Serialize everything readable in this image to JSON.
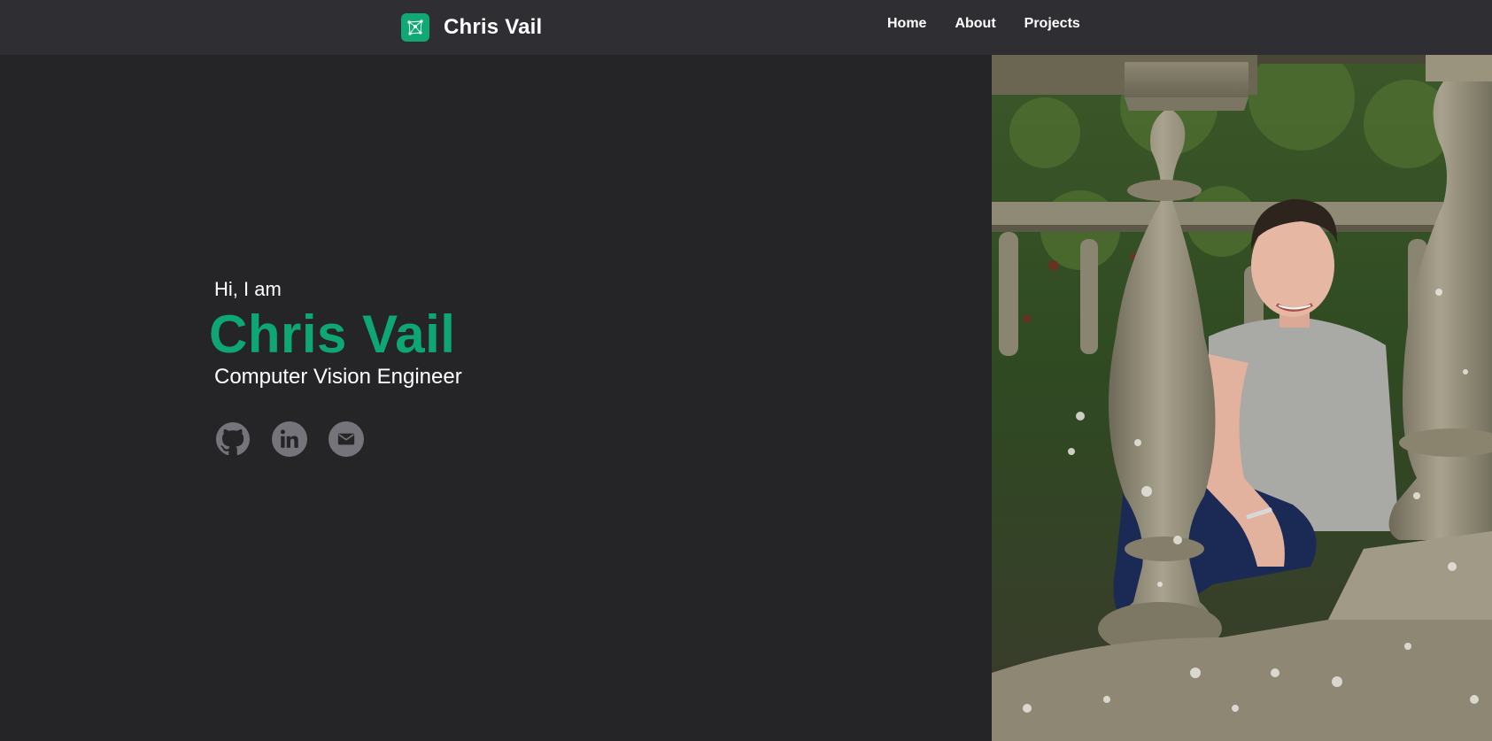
{
  "header": {
    "brand_name": "Chris Vail",
    "logo_icon": "network-nodes-icon",
    "nav": [
      {
        "label": "Home"
      },
      {
        "label": "About"
      },
      {
        "label": "Projects"
      }
    ]
  },
  "hero": {
    "greeting": "Hi, I am",
    "name": "Chris Vail",
    "role": "Computer Vision Engineer"
  },
  "socials": [
    {
      "icon": "github-icon"
    },
    {
      "icon": "linkedin-icon"
    },
    {
      "icon": "email-icon"
    }
  ],
  "colors": {
    "background": "#252528",
    "header": "#2f2e33",
    "accent": "#0ea774",
    "icon_gray": "#75747b"
  }
}
